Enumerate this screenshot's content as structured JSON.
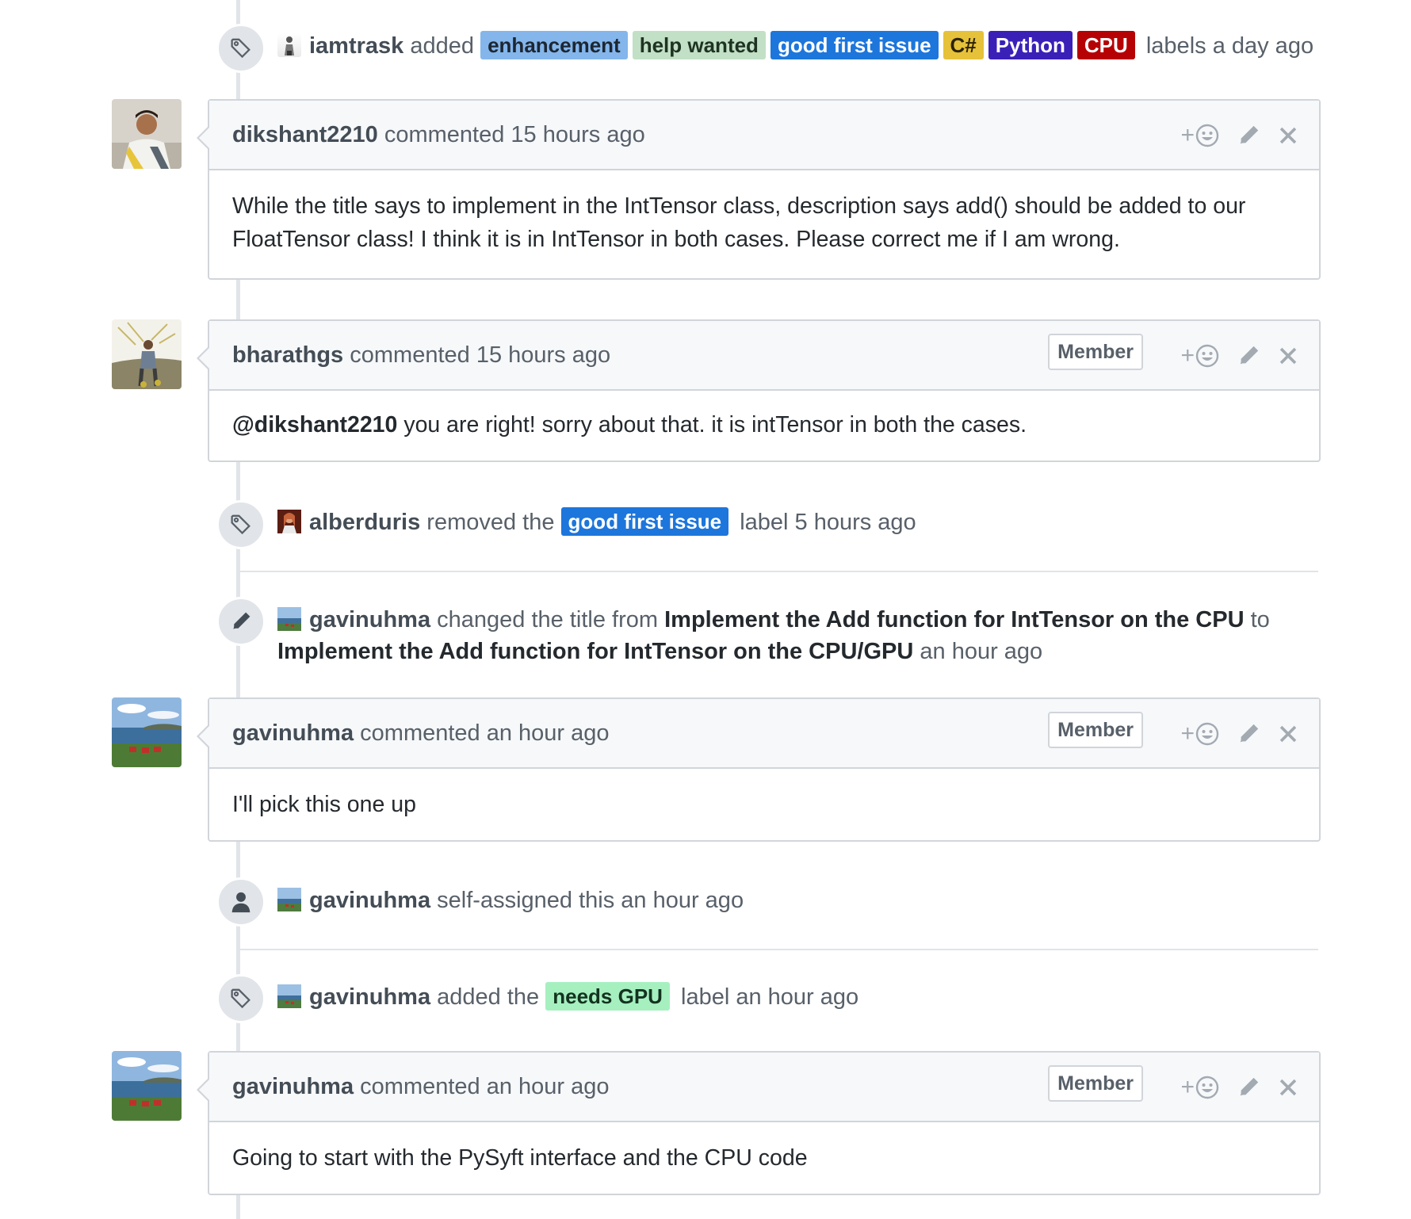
{
  "colors": {
    "enhancement": "#84b6eb",
    "help_wanted": "#c2e0c6",
    "good_first_issue": "#1d76db",
    "csharp": "#e6c13a",
    "python": "#3b20b8",
    "cpu": "#b60205",
    "needs_gpu": "#a6f0c0"
  },
  "event1": {
    "icon": "tag-icon",
    "actor": "iamtrask",
    "action": "added",
    "labels": [
      "enhancement",
      "help wanted",
      "good first issue",
      "C#",
      "Python",
      "CPU"
    ],
    "suffix": "labels a day ago"
  },
  "comment1": {
    "author": "dikshant2210",
    "meta": "commented 15 hours ago",
    "body": "While the title says to implement in the IntTensor class, description says add() should be added to our FloatTensor class! I think it is in IntTensor in both cases. Please correct me if I am wrong."
  },
  "comment2": {
    "author": "bharathgs",
    "meta": "commented 15 hours ago",
    "badge": "Member",
    "mention": "@dikshant2210",
    "body": "you are right! sorry about that. it is intTensor in both the cases."
  },
  "event2": {
    "icon": "tag-icon",
    "actor": "alberduris",
    "action": "removed the",
    "label": "good first issue",
    "suffix": "label 5 hours ago"
  },
  "event3": {
    "icon": "pencil-icon",
    "actor": "gavinuhma",
    "action": "changed the title from",
    "old_title": "Implement the Add function for IntTensor on the CPU",
    "to": "to",
    "new_title": "Implement the Add function for IntTensor on the CPU/GPU",
    "suffix": "an hour ago"
  },
  "comment3": {
    "author": "gavinuhma",
    "meta": "commented an hour ago",
    "badge": "Member",
    "body": "I'll pick this one up"
  },
  "event4": {
    "icon": "person-icon",
    "actor": "gavinuhma",
    "action": "self-assigned this an hour ago"
  },
  "event5": {
    "icon": "tag-icon",
    "actor": "gavinuhma",
    "action": "added the",
    "label": "needs GPU",
    "suffix": "label an hour ago"
  },
  "comment4": {
    "author": "gavinuhma",
    "meta": "commented an hour ago",
    "badge": "Member",
    "body": "Going to start with the PySyft interface and the CPU code"
  },
  "actions": {
    "add_reaction": "+"
  }
}
